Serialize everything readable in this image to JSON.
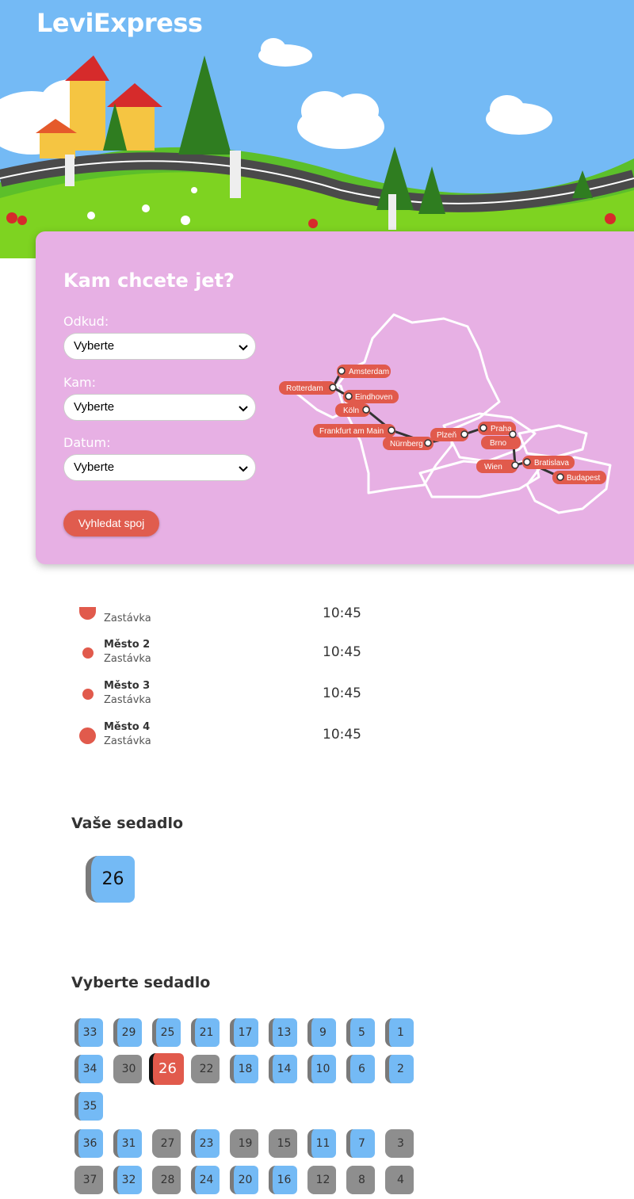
{
  "header": {
    "brand": "LeviExpress"
  },
  "search": {
    "title": "Kam chcete jet?",
    "from_label": "Odkud:",
    "from_value": "Vyberte",
    "to_label": "Kam:",
    "to_value": "Vyberte",
    "date_label": "Datum:",
    "date_value": "Vyberte",
    "button_label": "Vyhledat spoj"
  },
  "map": {
    "cities": [
      "Amsterdam",
      "Rotterdam",
      "Eindhoven",
      "Köln",
      "Frankfurt am Main",
      "Nürnberg",
      "Plzeň",
      "Praha",
      "Brno",
      "Wien",
      "Bratislava",
      "Budapest"
    ]
  },
  "route": {
    "stops": [
      {
        "name": "",
        "sub": "Zastávka",
        "time": "10:45"
      },
      {
        "name": "Město 2",
        "sub": "Zastávka",
        "time": "10:45"
      },
      {
        "name": "Město 3",
        "sub": "Zastávka",
        "time": "10:45"
      },
      {
        "name": "Město 4",
        "sub": "Zastávka",
        "time": "10:45"
      }
    ]
  },
  "your_seat": {
    "title": "Vaše sedadlo",
    "number": "26"
  },
  "seat_picker": {
    "title": "Vyberte sedadlo",
    "rows": [
      [
        "33",
        "29",
        "25",
        "21",
        "17",
        "13",
        "9",
        "5",
        "1"
      ],
      [
        "34",
        "30",
        "26",
        "22",
        "18",
        "14",
        "10",
        "6",
        "2"
      ],
      [
        "35"
      ],
      [
        "36",
        "31",
        "27",
        "23",
        "19",
        "15",
        "11",
        "7",
        "3"
      ],
      [
        "37",
        "32",
        "28",
        "24",
        "20",
        "16",
        "12",
        "8",
        "4"
      ]
    ],
    "taken": [
      "30",
      "22",
      "27",
      "19",
      "15",
      "3",
      "28",
      "12",
      "8",
      "4",
      "37"
    ],
    "selected": "26"
  },
  "colors": {
    "accent": "#e15a4c",
    "panel": "#e7b0e4",
    "sky": "#74baf5",
    "seat_free": "#74baf5",
    "seat_taken": "#8e8e8e"
  }
}
